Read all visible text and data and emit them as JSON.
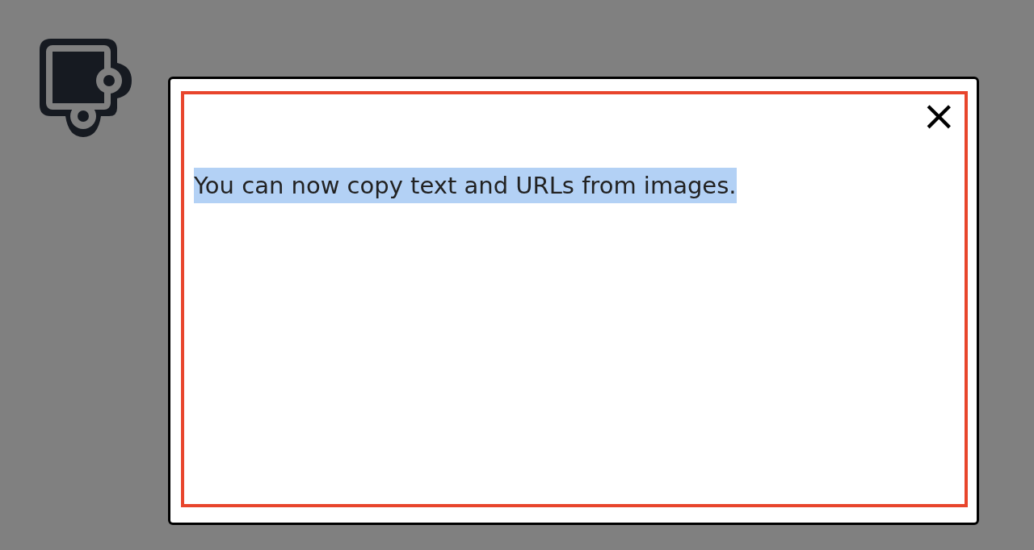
{
  "dialog": {
    "message": "You can now copy text and URLs from images.",
    "highlighted": true,
    "close_button": "×"
  }
}
